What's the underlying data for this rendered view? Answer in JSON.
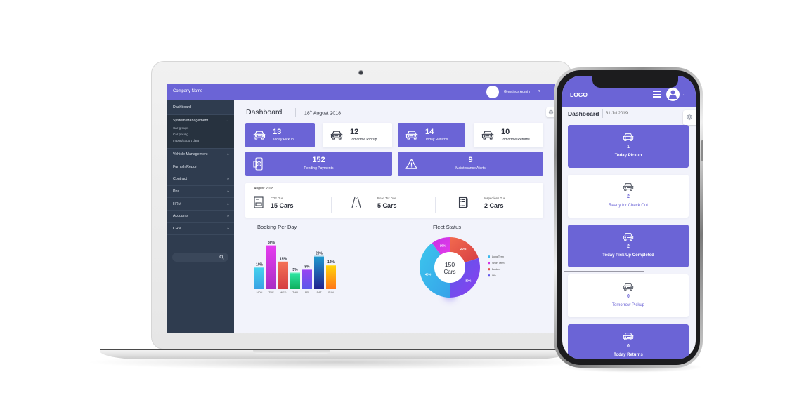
{
  "colors": {
    "brand_purple": "#6b64d6",
    "sidebar_bg": "#2f3c4f",
    "content_bg": "#f2f3fb"
  },
  "laptop": {
    "topbar": {
      "company_name": "Company Name",
      "greeting": "Greetings Admin",
      "caret": "▾"
    },
    "sidebar": {
      "items": [
        {
          "label": "Dashboard"
        },
        {
          "label": "System Management",
          "expanded": true,
          "arrow": "⌄",
          "children": [
            "Car groups",
            "Car pricing",
            "Import/Export data"
          ]
        },
        {
          "label": "Vehicle Management",
          "arrow": "▸"
        },
        {
          "label": "Furnish Report"
        },
        {
          "label": "Contract",
          "arrow": "▸"
        },
        {
          "label": "Pos",
          "arrow": "▸"
        },
        {
          "label": "HRM",
          "arrow": "▸"
        },
        {
          "label": "Accounts",
          "arrow": "▸"
        },
        {
          "label": "CRM",
          "arrow": "▸"
        }
      ],
      "search_placeholder": ""
    },
    "main": {
      "title": "Dashboard",
      "date_day": "18",
      "date_suffix": "th",
      "date_rest": " August 2018",
      "stats": [
        {
          "value": "13",
          "label": "Today Pickup",
          "icon": "car-icon",
          "theme": "purple"
        },
        {
          "value": "12",
          "label": "Tomorrow Pickup",
          "icon": "car-icon",
          "theme": "white"
        },
        {
          "value": "14",
          "label": "Today Returns",
          "icon": "car-icon",
          "theme": "purple"
        },
        {
          "value": "10",
          "label": "Tomorrow Returns",
          "icon": "car-icon",
          "theme": "white"
        }
      ],
      "wide_stats": [
        {
          "value": "152",
          "label": "Pending Payments",
          "icon": "payment-icon"
        },
        {
          "value": "9",
          "label": "Maintenance Alerts",
          "icon": "warning-icon"
        }
      ],
      "due_panel": {
        "period": "August 2018",
        "items": [
          {
            "label": "COE Due",
            "value": "15 Cars",
            "icon": "document-icon"
          },
          {
            "label": "Road Tax Due",
            "value": "5 Cars",
            "icon": "road-icon"
          },
          {
            "label": "Inspections Due",
            "value": "2 Cars",
            "icon": "checklist-icon"
          }
        ]
      }
    }
  },
  "phone": {
    "logo": "LOGO",
    "title": "Dashboard",
    "date": "31 Jul 2019",
    "caret": "⌄",
    "cards": [
      {
        "value": "1",
        "label": "Today Pickup",
        "theme": "purple",
        "icon": "car-icon"
      },
      {
        "value": "2",
        "label": "Ready for Check Out",
        "theme": "white",
        "icon": "car-icon"
      },
      {
        "value": "2",
        "label": "Today Pick Up Completed",
        "theme": "purple",
        "icon": "car-icon"
      },
      {
        "value": "0",
        "label": "Tomorrow Pickup",
        "theme": "white",
        "icon": "car-icon"
      },
      {
        "value": "0",
        "label": "Today Returns",
        "theme": "purple",
        "icon": "car-icon"
      }
    ]
  },
  "chart_data": [
    {
      "type": "bar",
      "title": "Booking Per Day",
      "xlabel": "",
      "ylabel": "",
      "categories": [
        "MON",
        "TUE",
        "WED",
        "THU",
        "FRI",
        "SAT",
        "SUN"
      ],
      "values": [
        10,
        30,
        15,
        5,
        8,
        20,
        12
      ],
      "value_labels": [
        "10%",
        "30%",
        "15%",
        "5%",
        "8%",
        "20%",
        "12%"
      ],
      "unit": "%",
      "grid": false,
      "colors": [
        [
          "#46d3ee",
          "#3aa2e4"
        ],
        [
          "#e63cf0",
          "#a92fc4"
        ],
        [
          "#f47256",
          "#d53d43"
        ],
        [
          "#2fe8a6",
          "#0fae5c"
        ],
        [
          "#9a44f2",
          "#5a57ea"
        ],
        [
          "#1f9bcf",
          "#22208f"
        ],
        [
          "#ffd60a",
          "#ff7518"
        ]
      ]
    },
    {
      "type": "pie",
      "title": "Fleet Status",
      "donut": true,
      "center_value": "150",
      "center_unit": "Cars",
      "slices": [
        {
          "name": "Booked",
          "value": 20,
          "label": "20%",
          "colors": [
            "#f26a4e",
            "#d63e43"
          ]
        },
        {
          "name": "Idle",
          "value": 30,
          "label": "30%",
          "colors": [
            "#5a58ea",
            "#8d3ff0"
          ]
        },
        {
          "name": "Long Term",
          "value": 40,
          "label": "40%",
          "colors": [
            "#3cc6ec",
            "#36a2ea"
          ]
        },
        {
          "name": "Short Term",
          "value": 10,
          "label": "10%",
          "colors": [
            "#c632e6",
            "#e33be8"
          ]
        }
      ],
      "legend": [
        {
          "name": "Long Term",
          "color": "#3cb8ec"
        },
        {
          "name": "Short Term",
          "color": "#d236e6"
        },
        {
          "name": "Booked",
          "color": "#e2504a"
        },
        {
          "name": "Idle",
          "color": "#6258ea"
        }
      ],
      "legend_position": "right"
    }
  ]
}
